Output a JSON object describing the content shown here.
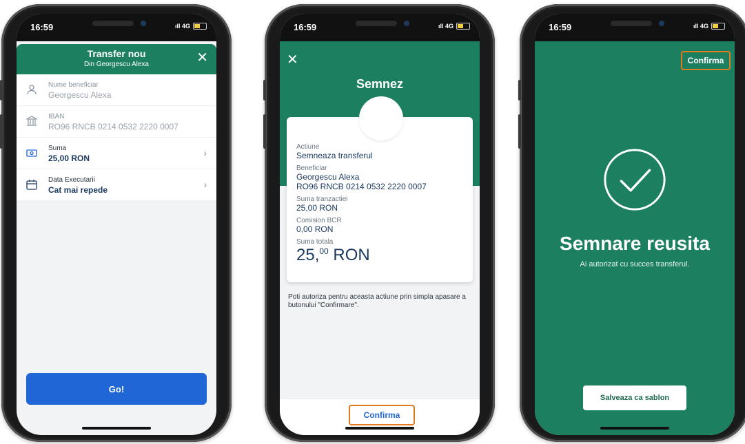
{
  "status_bar": {
    "time": "16:59",
    "network": "4G"
  },
  "screen1": {
    "header": {
      "title": "Transfer nou",
      "subtitle": "Din Georgescu Alexa"
    },
    "rows": [
      {
        "label": "Nume beneficiar",
        "value": "Georgescu Alexa",
        "icon": "person-icon"
      },
      {
        "label": "IBAN",
        "value": "RO96 RNCB 0214 0532 2220 0007",
        "icon": "bank-icon"
      },
      {
        "label": "Suma",
        "value": "25,00 RON",
        "icon": "money-icon"
      },
      {
        "label": "Data Executarii",
        "value": "Cat mai repede",
        "icon": "calendar-icon"
      }
    ],
    "go_label": "Go!"
  },
  "screen2": {
    "title": "Semnez",
    "fields": {
      "actiune_label": "Actiune",
      "actiune_value": "Semneaza transferul",
      "beneficiar_label": "Beneficiar",
      "beneficiar_name": "Georgescu Alexa",
      "beneficiar_iban": "RO96 RNCB 0214 0532 2220 0007",
      "suma_label": "Suma tranzactiei",
      "suma_value": "25,00 RON",
      "comision_label": "Comision BCR",
      "comision_value": "0,00 RON",
      "total_label": "Suma totala",
      "total_int": "25,",
      "total_dec": "00",
      "total_currency": "RON"
    },
    "note": "Poti autoriza pentru aceasta actiune prin simpla apasare a butonului \"Confirmare\".",
    "confirm_label": "Confirma"
  },
  "screen3": {
    "confirm_label": "Confirma",
    "title": "Semnare reusita",
    "subtitle": "Ai autorizat cu succes transferul.",
    "save_label": "Salveaza ca sablon"
  },
  "colors": {
    "brand_green": "#1c8060",
    "primary_blue": "#2166d6",
    "highlight_orange": "#e07a20"
  }
}
